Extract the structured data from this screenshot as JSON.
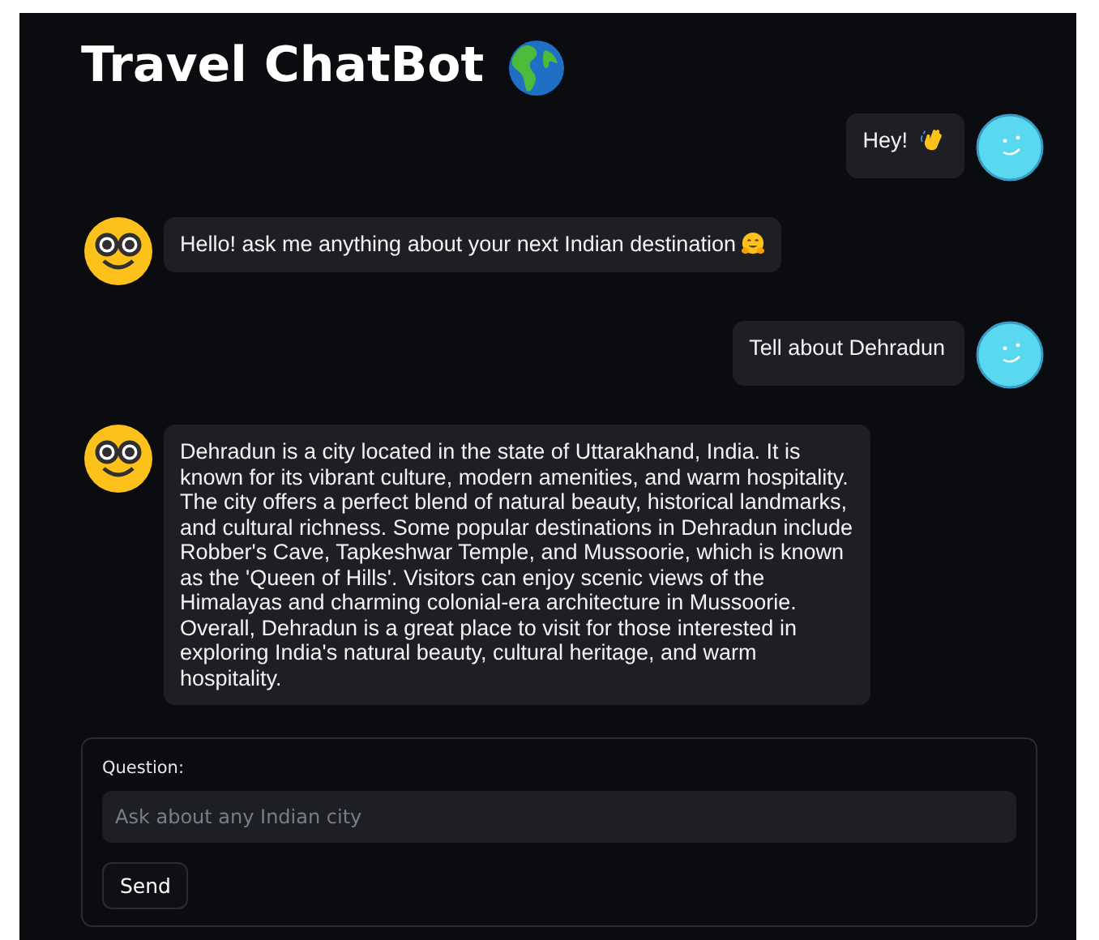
{
  "title": "Travel ChatBot",
  "messages": [
    {
      "kind": "user",
      "text": "Hey!",
      "emoji": {
        "kind": "wave"
      }
    },
    {
      "kind": "bot",
      "text": "Hello! ask me anything about your next Indian destination",
      "emoji": {
        "kind": "hug"
      }
    },
    {
      "kind": "user",
      "text": "Tell about Dehradun"
    },
    {
      "kind": "bot",
      "text": "Dehradun is a city located in the state of Uttarakhand, India. It is known for its vibrant culture, modern amenities, and warm hospitality. The city offers a perfect blend of natural beauty, historical landmarks, and cultural richness. Some popular destinations in Dehradun include Robber's Cave, Tapkeshwar Temple, and Mussoorie, which is known as the 'Queen of Hills'. Visitors can enjoy scenic views of the Himalayas and charming colonial-era architecture in Mussoorie. Overall, Dehradun is a great place to visit for those interested in exploring India's natural beauty, cultural heritage, and warm hospitality."
    }
  ],
  "question": {
    "label": "Question:",
    "placeholder": "Ask about any Indian city"
  },
  "send_button": "Send"
}
